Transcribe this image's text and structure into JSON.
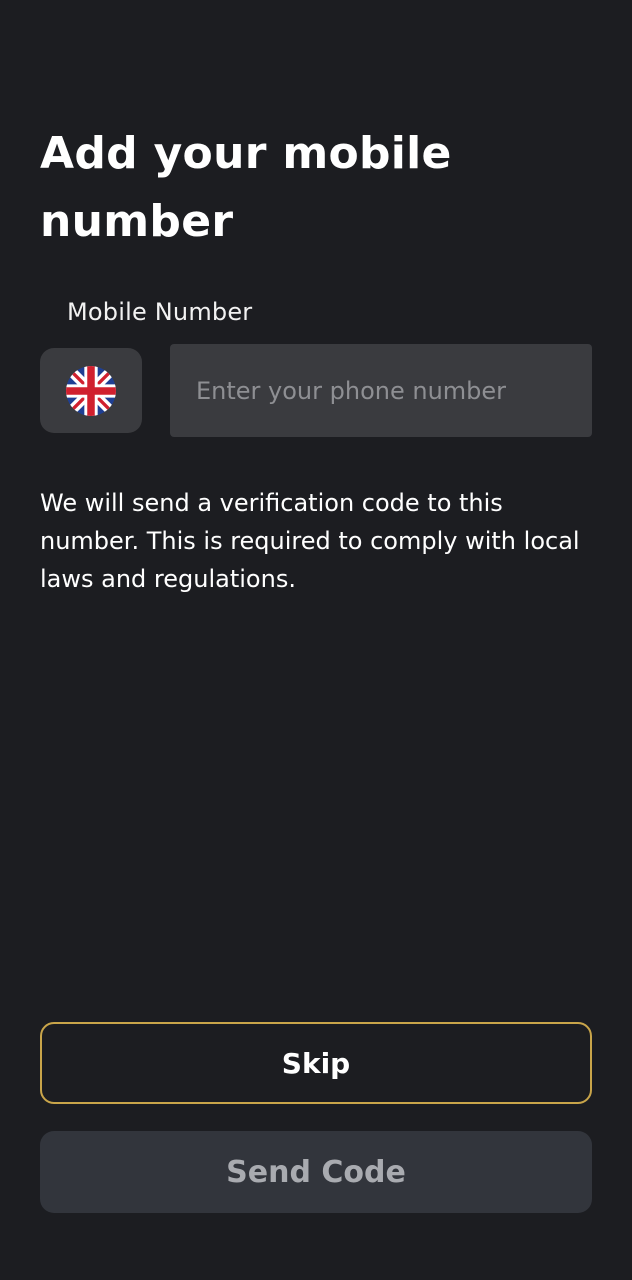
{
  "header": {
    "title": "Add your mobile number"
  },
  "phone_field": {
    "label": "Mobile Number",
    "placeholder": "Enter your phone number",
    "value": "",
    "country_icon": "uk-flag-icon"
  },
  "info": {
    "text": "We will send a verification code to this number. This is required to comply with local laws and regulations."
  },
  "actions": {
    "skip_label": "Skip",
    "send_label": "Send Code"
  },
  "colors": {
    "background": "#1c1d21",
    "field_background": "#3a3b3f",
    "skip_border": "#c9a54a",
    "send_background": "#32353c",
    "send_text": "#a9abb0"
  }
}
